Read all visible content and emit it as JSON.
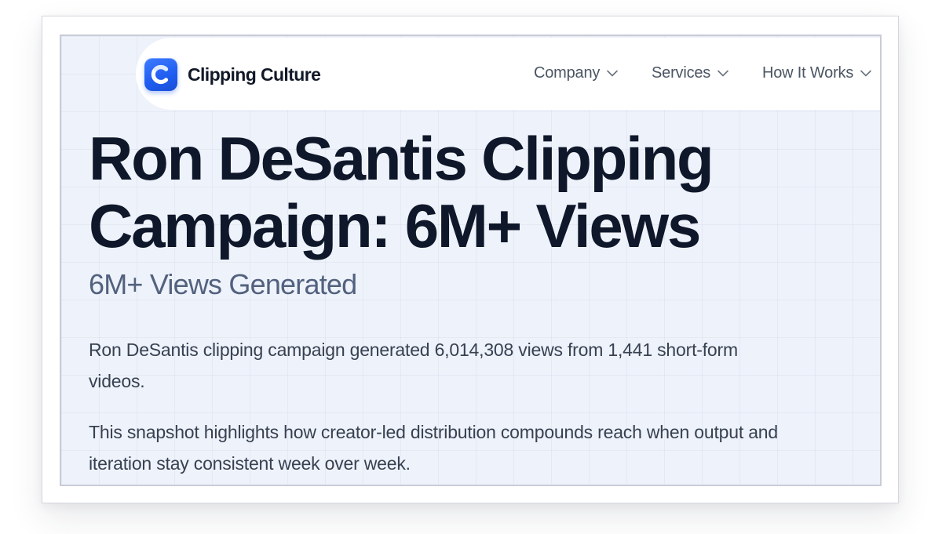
{
  "brand": {
    "name": "Clipping Culture",
    "logo_icon": "letter-c-logo-icon",
    "accent_color": "#1f5cf0"
  },
  "nav": {
    "items": [
      {
        "label": "Company",
        "icon": "chevron-down-icon"
      },
      {
        "label": "Services",
        "icon": "chevron-down-icon"
      },
      {
        "label": "How It Works",
        "icon": "chevron-down-icon"
      }
    ]
  },
  "hero": {
    "headline": "Ron DeSantis Clipping Campaign: 6M+ Views",
    "subheadline": "6M+ Views Generated",
    "paragraphs": [
      "Ron DeSantis clipping campaign generated 6,014,308 views from 1,441 short-form videos.",
      "This snapshot highlights how creator-led distribution compounds reach when output and iteration stay consistent week over week."
    ]
  },
  "colors": {
    "headline": "#0f172a",
    "subheadline": "#52617e",
    "body_text": "#374151",
    "page_background": "#eef2fa"
  }
}
